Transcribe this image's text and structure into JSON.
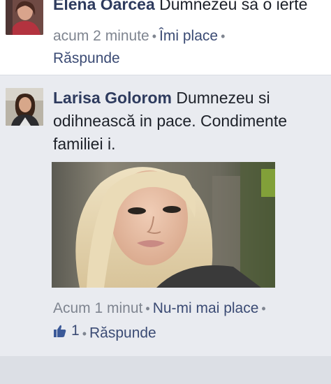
{
  "comments": [
    {
      "author": "Elena Oarcea",
      "text": "Dumnezeu să o ierte",
      "time": "acum 2 minute",
      "like_label": "Îmi place",
      "reply_label": "Răspunde"
    },
    {
      "author": "Larisa Golorom",
      "text": "Dumnezeu si odihnească in pace. Condimente familiei i.",
      "time": "Acum 1 minut",
      "like_label": "Nu-mi mai place",
      "like_count": "1",
      "reply_label": "Răspunde"
    }
  ],
  "colors": {
    "author": "#2e3b5e",
    "link": "#3b4b74",
    "meta": "#7f8590",
    "background_active": "#e9ebf0"
  },
  "icons": {
    "like": "thumbs-up-icon"
  }
}
